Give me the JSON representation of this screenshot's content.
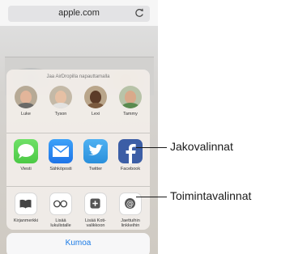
{
  "browser": {
    "url": "apple.com"
  },
  "share_sheet": {
    "airdrop_title": "Jaa AirDropilla napauttamalla",
    "contacts": [
      {
        "name": "Luke",
        "avatar": "person-avatar"
      },
      {
        "name": "Tyson",
        "avatar": "person-avatar"
      },
      {
        "name": "Lexi",
        "avatar": "person-avatar"
      },
      {
        "name": "Tammy",
        "avatar": "person-avatar"
      }
    ],
    "share_apps": [
      {
        "label": "Viesti",
        "icon": "messages-icon",
        "color": "#5fd75a"
      },
      {
        "label": "Sähköposti",
        "icon": "mail-icon",
        "color": "#2f8cf3"
      },
      {
        "label": "Twitter",
        "icon": "twitter-icon",
        "color": "#3aa1ec"
      },
      {
        "label": "Facebook",
        "icon": "facebook-icon",
        "color": "#3c5ea6"
      }
    ],
    "actions": [
      {
        "label": "Kirjanmerkki",
        "icon": "book-icon"
      },
      {
        "label": "Lisää lukulistalle",
        "icon": "glasses-icon"
      },
      {
        "label": "Lisää Koti-valikkoon",
        "icon": "plus-square-icon"
      },
      {
        "label": "Jaettuihin linkkeihin",
        "icon": "at-sign-icon"
      }
    ],
    "cancel_label": "Kumoa"
  },
  "callouts": {
    "share_options": "Jakovalinnat",
    "action_options": "Toimintavalinnat"
  }
}
